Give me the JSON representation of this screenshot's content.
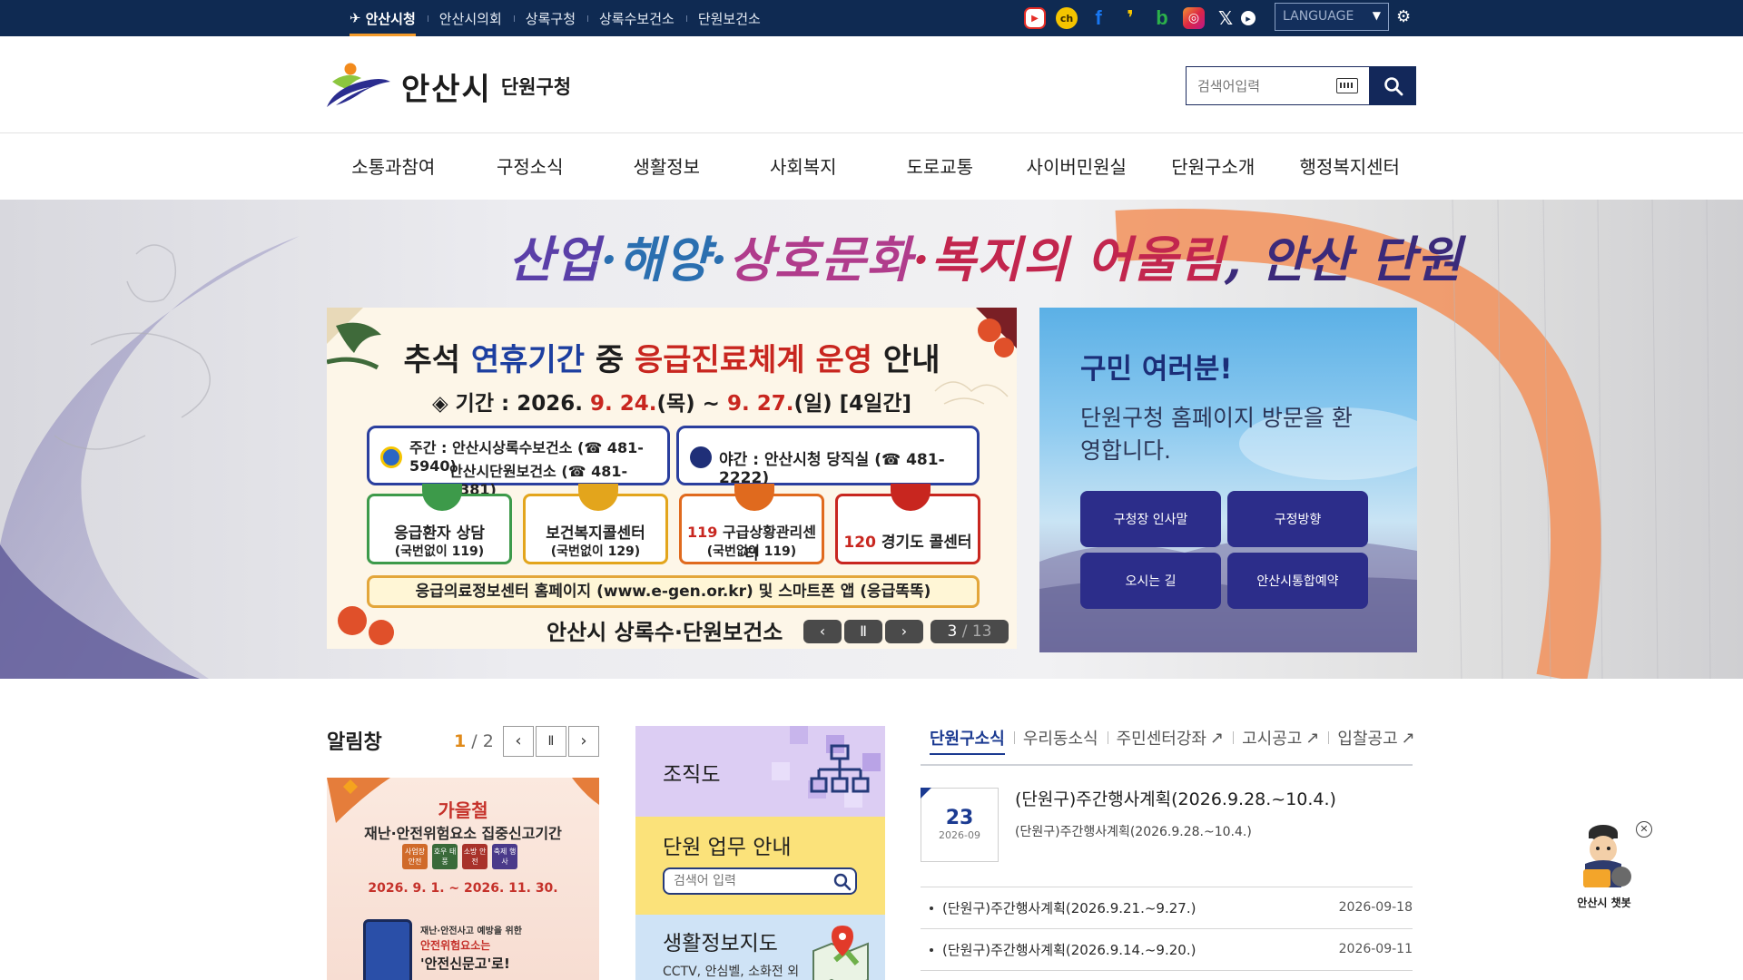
{
  "topnav": {
    "items": [
      {
        "label": "안산시청",
        "active": true
      },
      {
        "label": "안산시의회",
        "active": false
      },
      {
        "label": "상록구청",
        "active": false
      },
      {
        "label": "상록수보건소",
        "active": false
      },
      {
        "label": "단원보건소",
        "active": false
      }
    ],
    "social": [
      {
        "icon": "youtube-icon",
        "glyph": "▶",
        "color": "#e52d27"
      },
      {
        "icon": "channel-icon",
        "glyph": "ch",
        "color": "#f5c400"
      },
      {
        "icon": "facebook-icon",
        "glyph": "f",
        "color": "#1877f2"
      },
      {
        "icon": "kakao-story-icon",
        "glyph": "❜",
        "color": "#f7c600"
      },
      {
        "icon": "band-icon",
        "glyph": "b",
        "color": "#2cb24a"
      },
      {
        "icon": "instagram-icon",
        "glyph": "◎",
        "color": "#d6249f"
      },
      {
        "icon": "x-icon",
        "glyph": "𝕏",
        "color": "#0f2a52"
      },
      {
        "icon": "play-circle-icon",
        "glyph": "▸",
        "color": "#0f2a52"
      }
    ],
    "language": "LANGUAGE"
  },
  "header": {
    "logo_name": "안산시",
    "logo_sub": "단원구청",
    "search_placeholder": "검색어입력"
  },
  "gnb": [
    "소통과참여",
    "구정소식",
    "생활정보",
    "사회복지",
    "도로교통",
    "사이버민원실",
    "단원구소개",
    "행정복지센터"
  ],
  "hero": {
    "slogan": [
      "산업",
      "·해양·",
      "상호문화",
      "·복지의 ",
      "어울림",
      ", 안산 단원"
    ],
    "banner": {
      "title_a": "추석 ",
      "title_b": "연휴기간",
      "title_c": " 중 ",
      "title_d": "응급진료체계 운영",
      "title_e": " 안내",
      "period_label": "◈ 기간 : 2026. ",
      "period_start": "9. 24.",
      "period_mid": "(목) ~ ",
      "period_end": "9. 27.",
      "period_tail": "(일) [4일간]",
      "day_line1": "주간 : 안산시상록수보건소 (☎ 481-5940)",
      "day_line2": "안산시단원보건소    (☎ 481-6381)",
      "night_line": "야간 : 안산시청 당직실 (☎ 481-2222)",
      "cards": [
        {
          "line1": "응급환자 상담",
          "line2": "(국번없이 119)",
          "prefix": ""
        },
        {
          "line1": "보건복지콜센터",
          "line2": "(국번없이 129)",
          "prefix": ""
        },
        {
          "line1": "구급상황관리센터",
          "line2": "(국번없이 119)",
          "prefix": "119 "
        },
        {
          "line1": "경기도 콜센터",
          "line2": "",
          "prefix": "120 "
        }
      ],
      "info": "응급의료정보센터 홈페이지 (www.e-gen.or.kr) 및 스마트폰 앱 (응급똑똑)",
      "footer": "안산시 상록수·단원보건소",
      "counter_current": "3",
      "counter_total": "13"
    },
    "welcome": {
      "title": "구민 여러분!",
      "text": "단원구청 홈페이지 방문을 환영합니다.",
      "buttons": [
        "구청장 인사말",
        "구정방향",
        "오시는 길",
        "안산시통합예약"
      ]
    }
  },
  "notice": {
    "title": "알림창",
    "page_current": "1",
    "page_total": "2",
    "poster": {
      "title": "가을철",
      "subtitle": "재난·안전위험요소 집중신고기간",
      "tags": [
        "사업장 안전",
        "호우 태풍",
        "소방 안전",
        "축제 행사"
      ],
      "dates": "2026. 9. 1. ~ 2026. 11. 30.",
      "line1": "재난·안전사고 예방을 위한",
      "line2": "안전위험요소는",
      "line3": "'안전신문고'로!"
    }
  },
  "quick": {
    "org": "조직도",
    "work": "단원 업무 안내",
    "work_placeholder": "검색어 입력",
    "map": "생활정보지도",
    "map_sub": "CCTV, 안심벨, 소화전 외"
  },
  "news": {
    "tabs": [
      {
        "label": "단원구소식",
        "ext": false
      },
      {
        "label": "우리동소식",
        "ext": false
      },
      {
        "label": "주민센터강좌",
        "ext": true
      },
      {
        "label": "고시공고",
        "ext": true
      },
      {
        "label": "입찰공고",
        "ext": true
      }
    ],
    "featured": {
      "day": "23",
      "ym": "2026-09",
      "title": "(단원구)주간행사계획(2026.9.28.~10.4.)",
      "subtitle": "(단원구)주간행사계획(2026.9.28.~10.4.)"
    },
    "rows": [
      {
        "title": "(단원구)주간행사계획(2026.9.21.~9.27.)",
        "date": "2026-09-18"
      },
      {
        "title": "(단원구)주간행사계획(2026.9.14.~9.20.)",
        "date": "2026-09-11"
      }
    ]
  },
  "chatbot": {
    "label": "안산시 챗봇"
  },
  "colors": {
    "navy": "#0f2a52",
    "accent": "#f39a2a",
    "button": "#2c2d8a",
    "link": "#1b3a91"
  }
}
